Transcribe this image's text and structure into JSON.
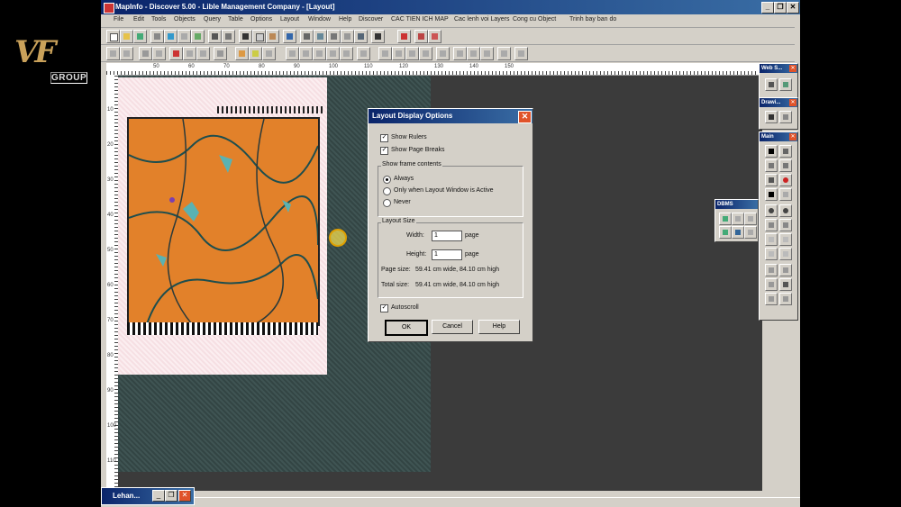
{
  "logo": {
    "mark": "VF",
    "text": "GROUP"
  },
  "window": {
    "title": "MapInfo - Discover 5.00 - Lible Management Company - [Layout]",
    "buttons": {
      "minimize": "_",
      "restore": "❐",
      "close": "✕"
    }
  },
  "menu": [
    "File",
    "Edit",
    "Tools",
    "Objects",
    "Query",
    "Table",
    "Options",
    "Layout",
    "Window",
    "Help",
    "Discover",
    "CAC TIEN ICH MAP",
    "Cac lenh voi Layers",
    "Cong cu Object",
    "Trinh bay ban do"
  ],
  "ruler": {
    "h": [
      "50",
      "60",
      "70",
      "80",
      "90",
      "100",
      "110",
      "120",
      "130",
      "140",
      "150"
    ],
    "v": [
      "10",
      "20",
      "30",
      "40",
      "50",
      "60",
      "70",
      "80",
      "90",
      "100",
      "110"
    ]
  },
  "dialog": {
    "title": "Layout Display Options",
    "close": "✕",
    "show_rulers": {
      "label": "Show Rulers",
      "checked": true
    },
    "show_page_breaks": {
      "label": "Show Page Breaks",
      "checked": true
    },
    "frame_group": "Show frame contents",
    "frame_options": [
      "Always",
      "Only when Layout Window is Active",
      "Never"
    ],
    "frame_selected": 0,
    "size_group": "Layout Size",
    "width_label": "Width:",
    "width_value": "1",
    "width_unit": "page",
    "height_label": "Height:",
    "height_value": "1",
    "height_unit": "page",
    "page_size_label": "Page size:",
    "page_size": "59.41 cm wide, 84.10 cm high",
    "total_size_label": "Total size:",
    "total_size": "59.41 cm wide, 84.10 cm high",
    "autoscroll": {
      "label": "Autoscroll",
      "checked": true
    },
    "ok": "OK",
    "cancel": "Cancel",
    "help": "Help"
  },
  "palettes": {
    "web": "Web S...",
    "drawing": "Drawi...",
    "main": "Main",
    "dbms": "DBMS"
  },
  "minimized": {
    "title": "Lehan...",
    "close": "✕"
  },
  "colors": {
    "title_blue": "#0a246a",
    "map_orange": "#e2812a",
    "page_pink": "#f6dfe3"
  }
}
